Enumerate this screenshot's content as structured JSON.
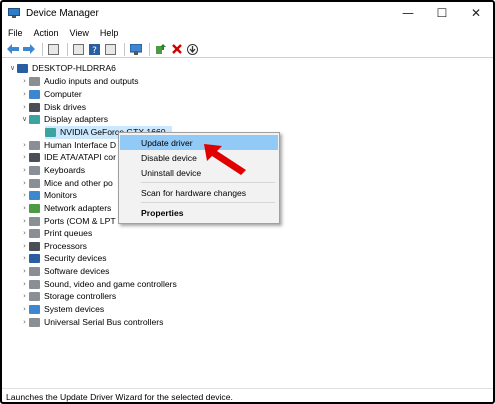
{
  "window": {
    "title": "Device Manager",
    "controls": {
      "minimize": "—",
      "maximize": "☐",
      "close": "✕"
    }
  },
  "menu": [
    "File",
    "Action",
    "View",
    "Help"
  ],
  "tree": {
    "root": "DESKTOP-HLDRRA6",
    "categories": [
      {
        "label": "Audio inputs and outputs",
        "icon": "speaker-icon"
      },
      {
        "label": "Computer",
        "icon": "computer-icon"
      },
      {
        "label": "Disk drives",
        "icon": "disk-icon"
      },
      {
        "label": "Display adapters",
        "icon": "display-icon",
        "expanded": true,
        "child": "NVIDIA GeForce GTX 1660"
      },
      {
        "label": "Human Interface D",
        "icon": "hid-icon"
      },
      {
        "label": "IDE ATA/ATAPI cor",
        "icon": "ide-icon"
      },
      {
        "label": "Keyboards",
        "icon": "keyboard-icon"
      },
      {
        "label": "Mice and other po",
        "icon": "mouse-icon"
      },
      {
        "label": "Monitors",
        "icon": "monitor-icon"
      },
      {
        "label": "Network adapters",
        "icon": "network-icon"
      },
      {
        "label": "Ports (COM & LPT",
        "icon": "port-icon"
      },
      {
        "label": "Print queues",
        "icon": "printer-icon"
      },
      {
        "label": "Processors",
        "icon": "processor-icon"
      },
      {
        "label": "Security devices",
        "icon": "security-icon"
      },
      {
        "label": "Software devices",
        "icon": "software-icon"
      },
      {
        "label": "Sound, video and game controllers",
        "icon": "sound-icon"
      },
      {
        "label": "Storage controllers",
        "icon": "storage-icon"
      },
      {
        "label": "System devices",
        "icon": "system-icon"
      },
      {
        "label": "Universal Serial Bus controllers",
        "icon": "usb-icon"
      }
    ]
  },
  "context_menu": {
    "update": "Update driver",
    "disable": "Disable device",
    "uninstall": "Uninstall device",
    "scan": "Scan for hardware changes",
    "properties": "Properties"
  },
  "status": "Launches the Update Driver Wizard for the selected device.",
  "colors": {
    "highlight": "#91c9f7",
    "arrow": "#e00000",
    "selection": "#cce8ff"
  }
}
